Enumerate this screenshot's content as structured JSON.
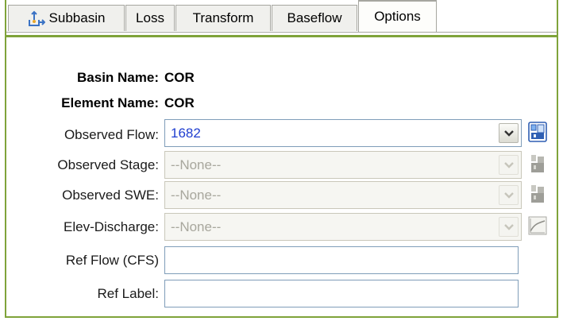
{
  "tabs": [
    {
      "label": "Subbasin",
      "icon": "subbasin-icon",
      "active": false
    },
    {
      "label": "Loss",
      "active": false
    },
    {
      "label": "Transform",
      "active": false
    },
    {
      "label": "Baseflow",
      "active": false
    },
    {
      "label": "Options",
      "active": true
    }
  ],
  "info": {
    "basin_label": "Basin Name:",
    "basin_value": "COR",
    "element_label": "Element Name:",
    "element_value": "COR"
  },
  "fields": {
    "observed_flow": {
      "label": "Observed Flow:",
      "value": "1682",
      "enabled": true
    },
    "observed_stage": {
      "label": "Observed Stage:",
      "value": "--None--",
      "enabled": false
    },
    "observed_swe": {
      "label": "Observed SWE:",
      "value": "--None--",
      "enabled": false
    },
    "elev_discharge": {
      "label": "Elev-Discharge:",
      "value": "--None--",
      "enabled": false
    },
    "ref_flow": {
      "label": "Ref Flow (CFS)",
      "value": ""
    },
    "ref_label": {
      "label": "Ref Label:",
      "value": ""
    }
  },
  "colors": {
    "frame": "#7fa33a",
    "active_tab_highlight": "#f7b13b",
    "value_text": "#1f3ed0"
  }
}
